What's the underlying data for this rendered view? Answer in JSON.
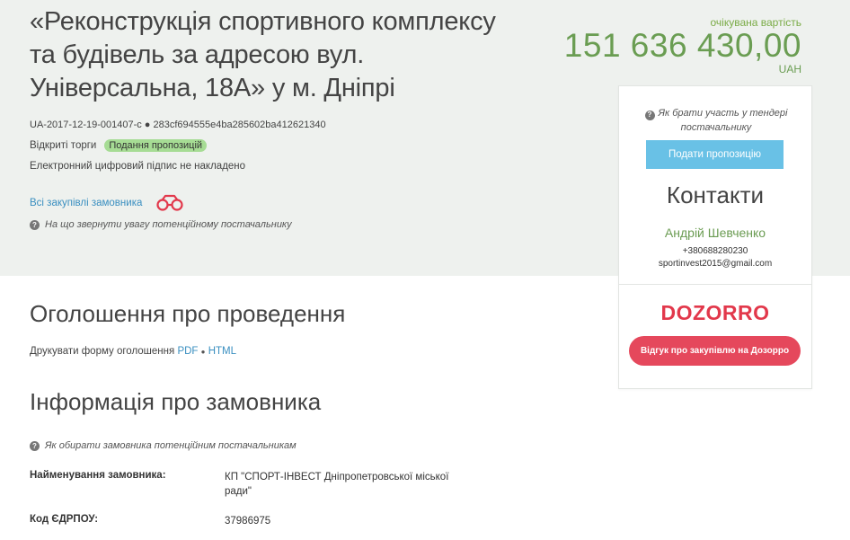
{
  "tender": {
    "title": "«Реконструкція спортивного комплексу та будівель за адресою вул. Універсальна, 18А» у м. Дніпрі",
    "id_line": "UA-2017-12-19-001407-c ● 283cf694555e4ba285602ba412621340",
    "procedure": "Відкриті торги",
    "status": "Подання пропозицій",
    "signature": "Електронний цифровий підпис не накладено",
    "all_purchases_link": "Всі закупівлі замовника",
    "hint_supplier": "На що звернути увагу потенційному постачальнику"
  },
  "price": {
    "label": "очікувана вартість",
    "value": "151 636 430,00",
    "currency": "UAH"
  },
  "card": {
    "hint": "Як брати участь у тендері постачальнику",
    "submit_button": "Подати пропозицію",
    "contacts_title": "Контакти",
    "contact_name": "Андрій Шевченко",
    "contact_phone": "+380688280230",
    "contact_email": "sportinvest2015@gmail.com",
    "logo_text": "DOZORRO",
    "dozorro_button": "Відгук про закупівлю на Дозорро"
  },
  "announcement": {
    "title": "Оголошення про проведення",
    "print_label": "Друкувати форму оголошення",
    "pdf_link": "PDF",
    "separator": "●",
    "html_link": "HTML"
  },
  "customer": {
    "title": "Інформація про замовника",
    "hint": "Як обирати замовника потенційним постачальникам",
    "fields": [
      {
        "label": "Найменування замовника:",
        "value": "КП \"СПОРТ-ІНВЕСТ Дніпропетровської міської ради\""
      },
      {
        "label": "Код ЄДРПОУ:",
        "value": "37986975"
      }
    ]
  },
  "colors": {
    "hero_bg": "#eef1ee",
    "price_green": "#6a9d52",
    "status_badge": "#a6dc94",
    "submit_blue": "#69c1e6",
    "dozorro_red": "#e5485c",
    "link_blue": "#3a8fc0"
  },
  "icons": {
    "binoculars": "binoculars-icon",
    "question": "question-circle-icon"
  }
}
